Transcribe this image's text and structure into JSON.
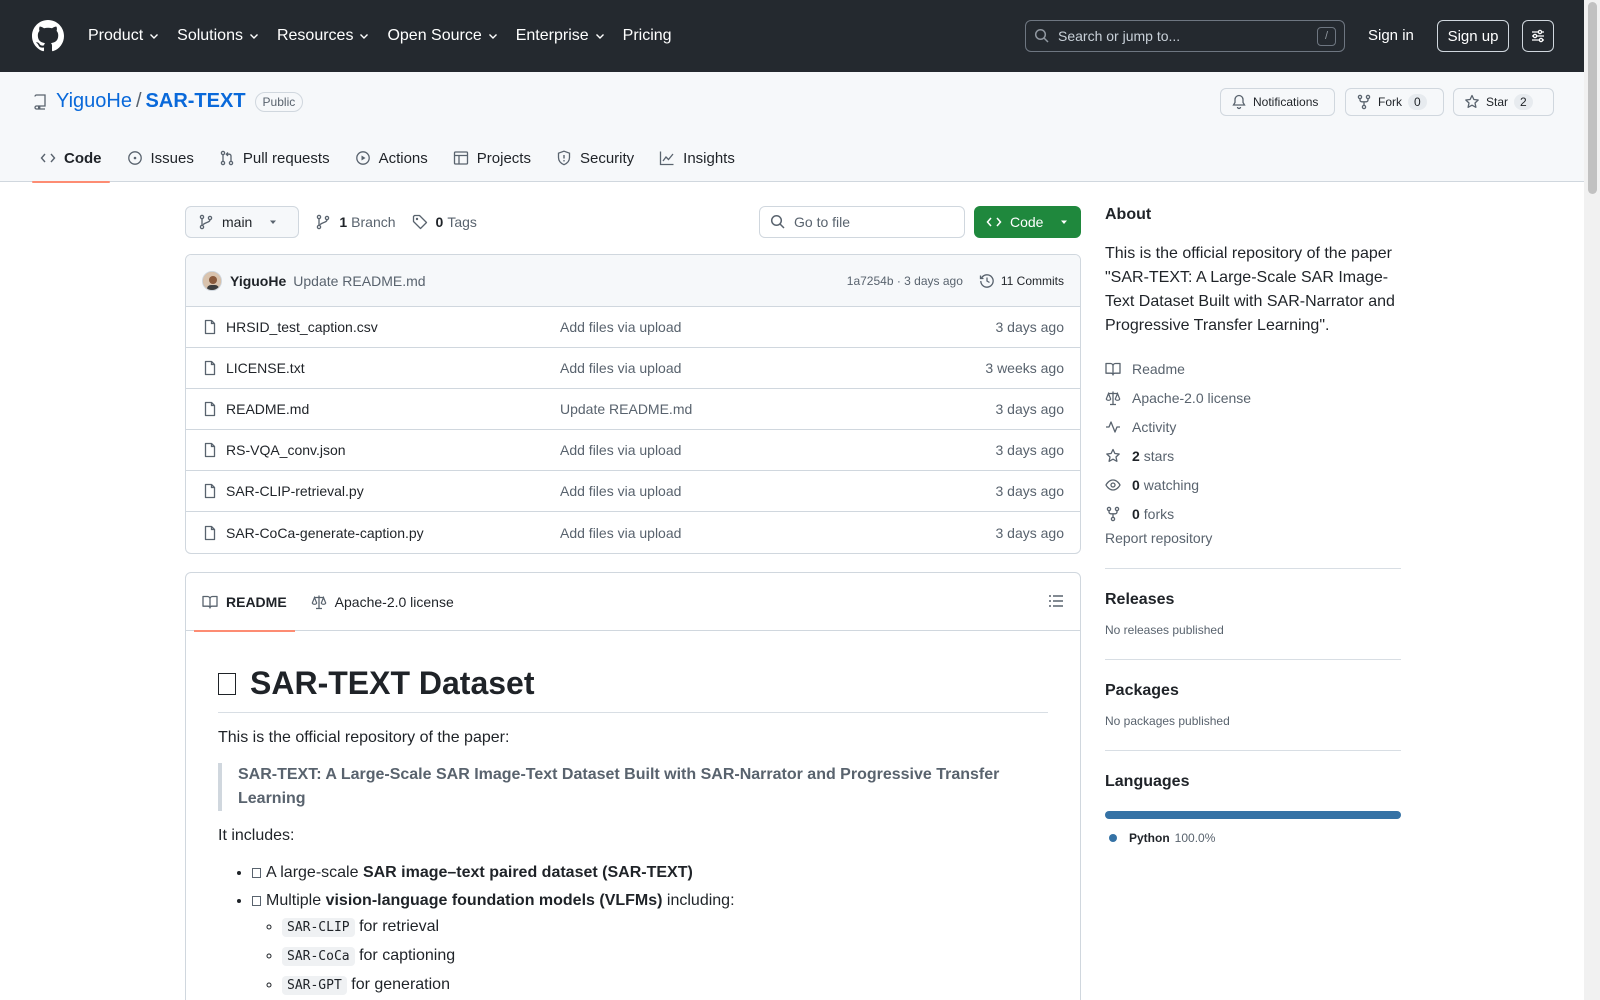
{
  "header": {
    "nav": [
      "Product",
      "Solutions",
      "Resources",
      "Open Source",
      "Enterprise",
      "Pricing"
    ],
    "search_placeholder": "Search or jump to...",
    "search_shortcut": "/",
    "sign_in": "Sign in",
    "sign_up": "Sign up"
  },
  "repo": {
    "owner": "YiguoHe",
    "separator": "/",
    "name": "SAR-TEXT",
    "visibility": "Public",
    "notifications_label": "Notifications",
    "fork_label": "Fork",
    "fork_count": "0",
    "star_label": "Star",
    "star_count": "2"
  },
  "tabs": [
    "Code",
    "Issues",
    "Pull requests",
    "Actions",
    "Projects",
    "Security",
    "Insights"
  ],
  "toolbar": {
    "branch": "main",
    "branch_count": "1",
    "branch_label": "Branch",
    "tag_count": "0",
    "tag_label": "Tags",
    "goto_placeholder": "Go to file",
    "code_label": "Code"
  },
  "commit": {
    "author": "YiguoHe",
    "message": "Update README.md",
    "sha_date": "1a7254b · 3 days ago",
    "commits": "11 Commits"
  },
  "files": [
    {
      "name": "HRSID_test_caption.csv",
      "message": "Add files via upload",
      "date": "3 days ago"
    },
    {
      "name": "LICENSE.txt",
      "message": "Add files via upload",
      "date": "3 weeks ago"
    },
    {
      "name": "README.md",
      "message": "Update README.md",
      "date": "3 days ago"
    },
    {
      "name": "RS-VQA_conv.json",
      "message": "Add files via upload",
      "date": "3 days ago"
    },
    {
      "name": "SAR-CLIP-retrieval.py",
      "message": "Add files via upload",
      "date": "3 days ago"
    },
    {
      "name": "SAR-CoCa-generate-caption.py",
      "message": "Add files via upload",
      "date": "3 days ago"
    }
  ],
  "readme": {
    "tab_readme": "README",
    "tab_license": "Apache-2.0 license",
    "title": "SAR-TEXT Dataset",
    "intro": "This is the official repository of the paper:",
    "quote": "SAR-TEXT: A Large-Scale SAR Image-Text Dataset Built with SAR-Narrator and Progressive Transfer Learning",
    "includes": "It includes:",
    "item1_pre": "A large-scale ",
    "item1_bold": "SAR image–text paired dataset (SAR-TEXT)",
    "item2_pre": "Multiple ",
    "item2_bold": "vision-language foundation models (VLFMs)",
    "item2_post": " including:",
    "models": [
      {
        "code": "SAR-CLIP",
        "text": " for retrieval"
      },
      {
        "code": "SAR-CoCa",
        "text": " for captioning"
      },
      {
        "code": "SAR-GPT",
        "text": " for generation"
      }
    ]
  },
  "about": {
    "heading": "About",
    "description": "This is the official repository of the paper \"SAR-TEXT: A Large-Scale SAR Image-Text Dataset Built with SAR-Narrator and Progressive Transfer Learning\".",
    "readme": "Readme",
    "license": "Apache-2.0 license",
    "activity": "Activity",
    "stars_count": "2",
    "stars_label": "stars",
    "watching_count": "0",
    "watching_label": "watching",
    "forks_count": "0",
    "forks_label": "forks",
    "report": "Report repository"
  },
  "releases": {
    "heading": "Releases",
    "note": "No releases published"
  },
  "packages": {
    "heading": "Packages",
    "note": "No packages published"
  },
  "languages": {
    "heading": "Languages",
    "items": [
      {
        "name": "Python",
        "pct": "100.0%",
        "fraction": 1.0,
        "color": "#3572A5"
      }
    ]
  },
  "colors": {
    "header_bg": "#24292f",
    "accent": "#0969da",
    "primary_button": "#1f883d",
    "tab_underline": "#fd8c73"
  }
}
